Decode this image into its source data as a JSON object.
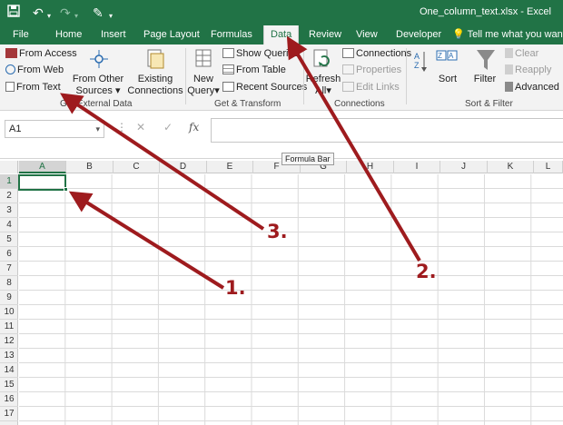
{
  "window": {
    "filename": "One_column_text.xlsx - Excel"
  },
  "quick_access": {
    "icons": [
      "save-icon",
      "undo-icon",
      "redo-icon",
      "customize-icon"
    ]
  },
  "tabs": [
    {
      "label": "File"
    },
    {
      "label": "Home"
    },
    {
      "label": "Insert"
    },
    {
      "label": "Page Layout"
    },
    {
      "label": "Formulas"
    },
    {
      "label": "Data",
      "active": true
    },
    {
      "label": "Review"
    },
    {
      "label": "View"
    },
    {
      "label": "Developer"
    }
  ],
  "tell_me": "Tell me what you want to",
  "ribbon": {
    "get_external": {
      "from_access": "From Access",
      "from_web": "From Web",
      "from_text": "From Text",
      "from_other_1": "From Other",
      "from_other_2": "Sources",
      "existing_1": "Existing",
      "existing_2": "Connections",
      "group_label": "Get External Data"
    },
    "get_transform": {
      "new_query_1": "New",
      "new_query_2": "Query",
      "show_queries": "Show Queries",
      "from_table": "From Table",
      "recent_sources": "Recent Sources",
      "group_label": "Get & Transform"
    },
    "connections": {
      "refresh_1": "Refresh",
      "refresh_2": "All",
      "connections": "Connections",
      "properties": "Properties",
      "edit_links": "Edit Links",
      "group_label": "Connections"
    },
    "sort_filter": {
      "sort": "Sort",
      "filter": "Filter",
      "clear": "Clear",
      "reapply": "Reapply",
      "advanced": "Advanced",
      "group_label": "Sort & Filter"
    }
  },
  "formula_bar": {
    "name_box": "A1",
    "fx": "fx",
    "tooltip": "Formula Bar",
    "cancel": "✕",
    "enter": "✓"
  },
  "grid": {
    "columns": [
      "A",
      "B",
      "C",
      "D",
      "E",
      "F",
      "G",
      "H",
      "I",
      "J",
      "K",
      "L"
    ],
    "rows": [
      "1",
      "2",
      "3",
      "4",
      "5",
      "6",
      "7",
      "8",
      "9",
      "10",
      "11",
      "12",
      "13",
      "14",
      "15",
      "16",
      "17"
    ],
    "selected_cell": "A1"
  },
  "annotations": {
    "label_1": "1.",
    "label_2": "2.",
    "label_3": "3.",
    "color": "#9e1b1e"
  }
}
